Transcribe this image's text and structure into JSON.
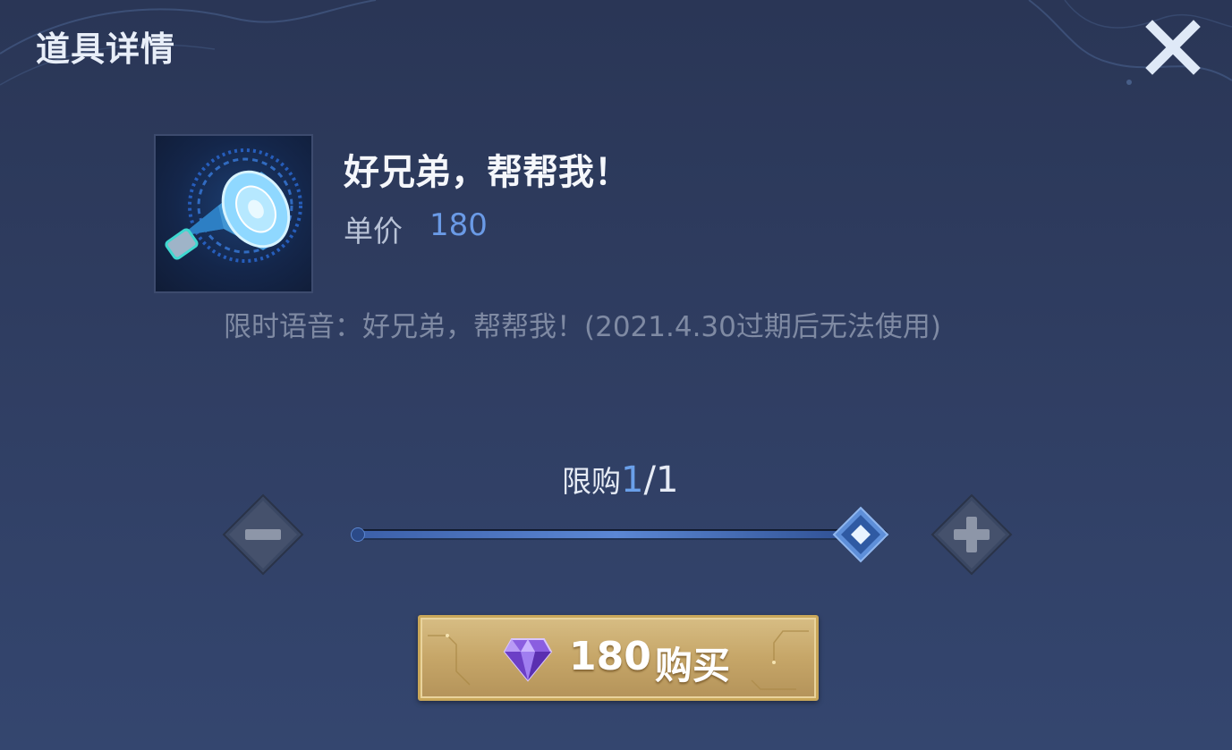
{
  "dialog": {
    "title": "道具详情",
    "close_icon": "close-icon"
  },
  "item": {
    "icon": "megaphone-icon",
    "name": "好兄弟，帮帮我！",
    "price_label": "单价",
    "price_value": "180",
    "description": "限时语音：好兄弟，帮帮我！(2021.4.30过期后无法使用)"
  },
  "quantity": {
    "limit_label": "限购",
    "current": "1",
    "separator": "/",
    "max": "1",
    "slider_fraction": 1.0,
    "decrease_icon": "minus-icon",
    "increase_icon": "plus-icon"
  },
  "purchase": {
    "currency_icon": "diamond-gem-icon",
    "price": "180",
    "label": "购买"
  },
  "colors": {
    "accent_blue": "#6a9ae6",
    "button_gold": "#c6a668",
    "background": "#2f3d61"
  }
}
